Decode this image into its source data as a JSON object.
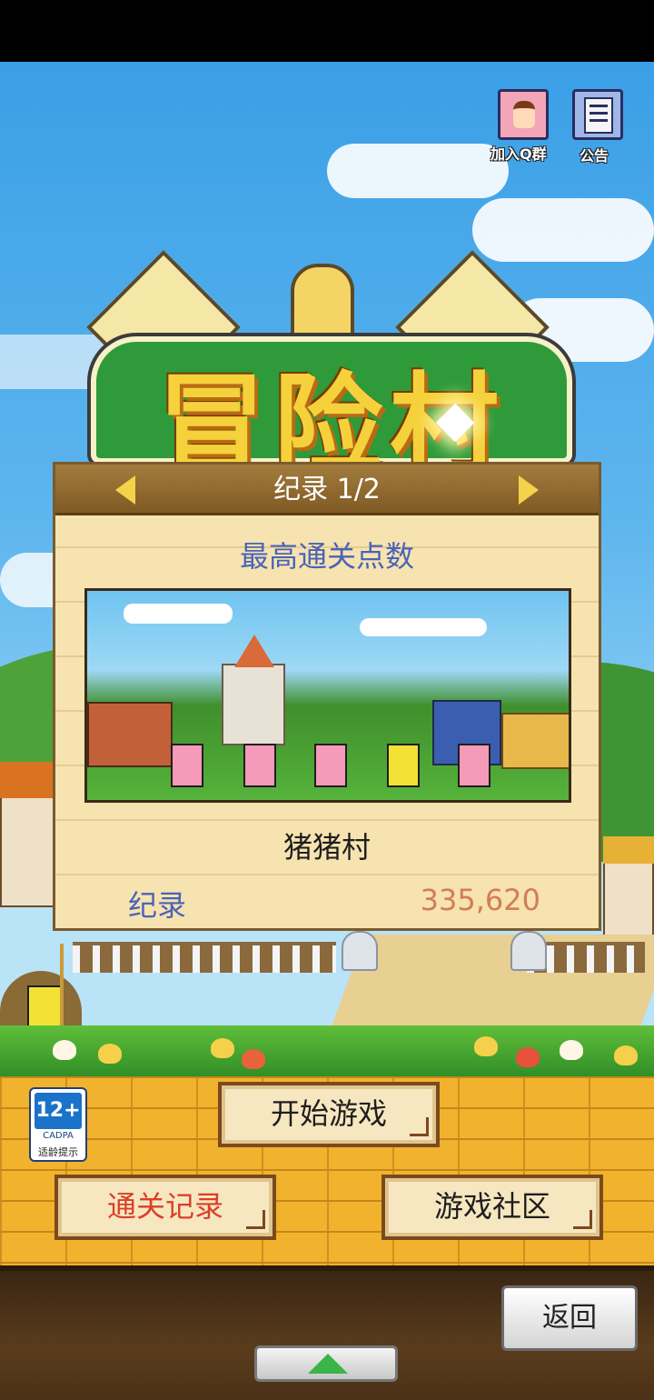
{
  "top_icons": {
    "qq_group_label": "加入Q群",
    "notice_label": "公告"
  },
  "game_logo": {
    "title": "冒险村"
  },
  "record_panel": {
    "header_title": "纪录 1/2",
    "subtitle": "最高通关点数",
    "village_name": "猪猪村",
    "record_label": "纪录",
    "record_value": "335,620"
  },
  "age_rating": {
    "age": "12+",
    "org": "CADPA",
    "note": "适龄提示"
  },
  "menu": {
    "start_game": "开始游戏",
    "clear_records": "通关记录",
    "community": "游戏社区",
    "back": "返回"
  },
  "colors": {
    "accent_blue": "#4a63b8",
    "record_value": "#d27d57",
    "panel_bg": "#f6e3b0",
    "header_brown": "#8c6830"
  }
}
